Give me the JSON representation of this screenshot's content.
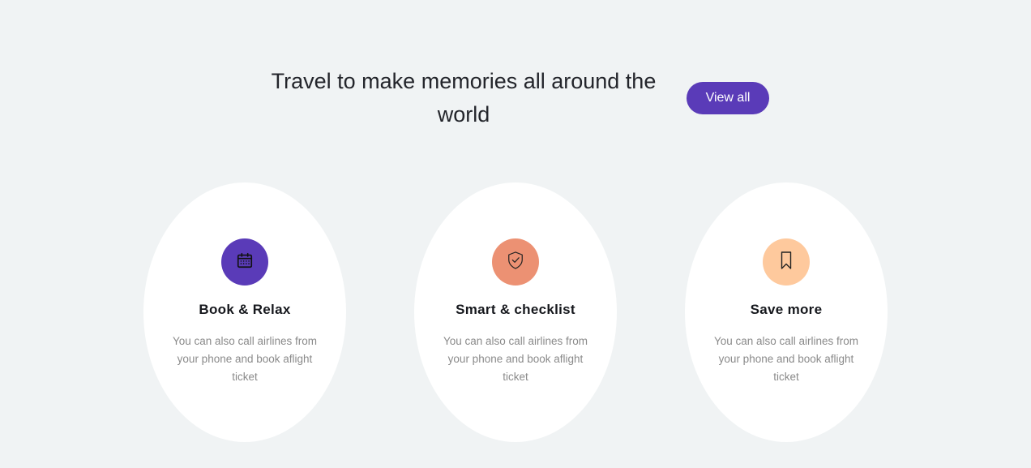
{
  "section": {
    "headline": "Travel to make memories all around the world",
    "view_all_label": "View all"
  },
  "colors": {
    "background": "#f0f3f4",
    "accent": "#5a3bb8",
    "card_1_icon_bg": "#5a3bb8",
    "card_2_icon_bg": "#ec9173",
    "card_3_icon_bg": "#fec99d"
  },
  "cards": [
    {
      "icon": "calendar-icon",
      "title": "Book & Relax",
      "description": "You can also call airlines from your phone and book aflight ticket"
    },
    {
      "icon": "shield-check-icon",
      "title": "Smart & checklist",
      "description": "You can also call airlines from your phone and book aflight ticket"
    },
    {
      "icon": "bookmark-icon",
      "title": "Save more",
      "description": "You can also call airlines from your phone and book aflight ticket"
    }
  ]
}
